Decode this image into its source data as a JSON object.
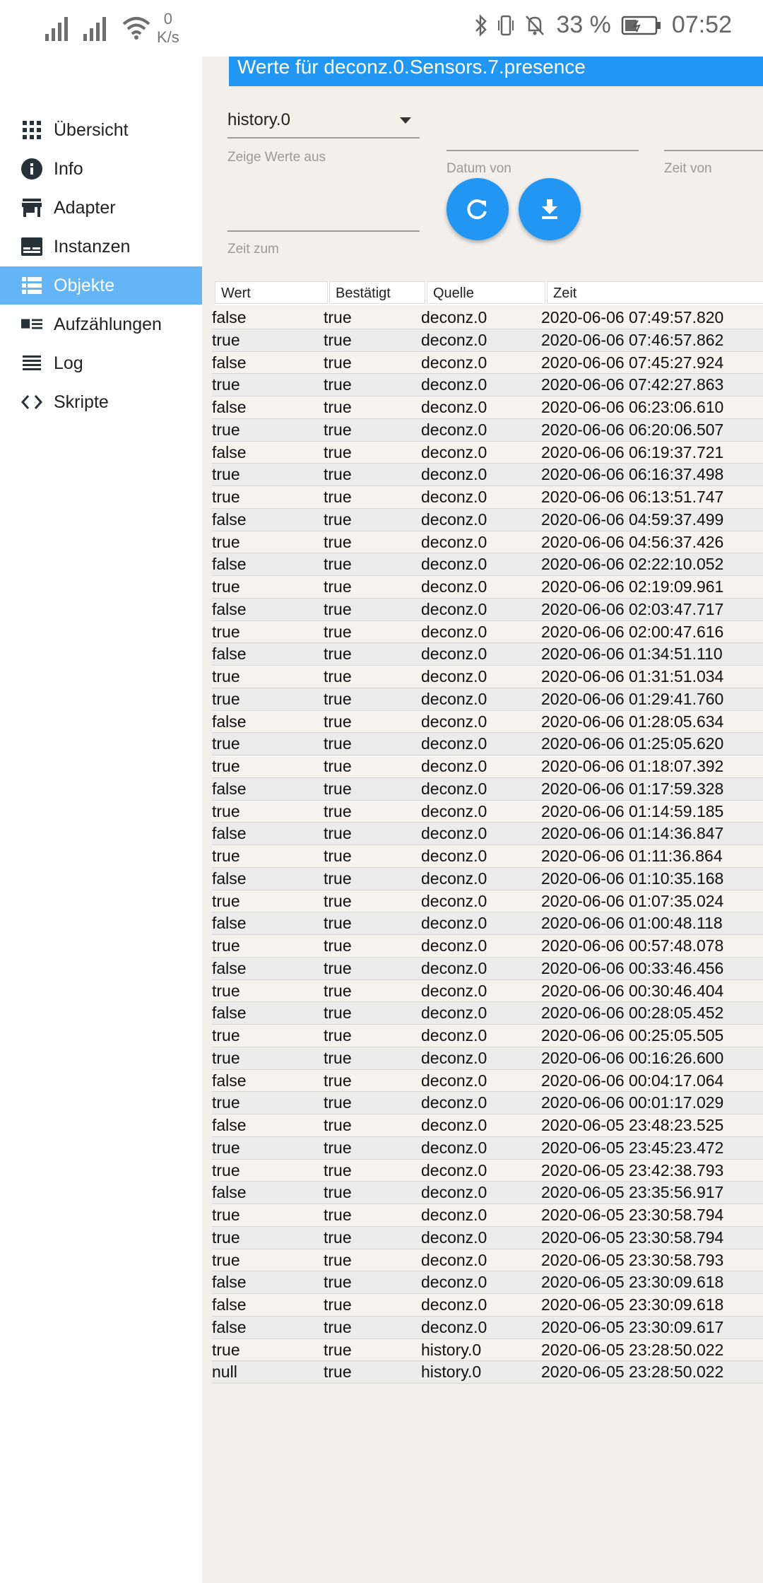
{
  "status_bar": {
    "net_speed_value": "0",
    "net_speed_unit": "K/s",
    "battery": "33 %",
    "time": "07:52"
  },
  "sidebar": {
    "items": [
      {
        "label": "Übersicht",
        "icon": "grid-icon"
      },
      {
        "label": "Info",
        "icon": "info-icon"
      },
      {
        "label": "Adapter",
        "icon": "store-icon"
      },
      {
        "label": "Instanzen",
        "icon": "instances-icon"
      },
      {
        "label": "Objekte",
        "icon": "list-icon",
        "active": true
      },
      {
        "label": "Aufzählungen",
        "icon": "enum-icon"
      },
      {
        "label": "Log",
        "icon": "log-icon"
      },
      {
        "label": "Skripte",
        "icon": "code-icon"
      }
    ],
    "active_color": "#64b5f6"
  },
  "main": {
    "title": "Werte für deconz.0.Sensors.7.presence",
    "accent": "#2196f3",
    "history_select": "history.0",
    "label_show_values": "Zeige Werte aus",
    "label_date_from": "Datum von",
    "label_time_from": "Zeit von",
    "label_time_to": "Zeit zum",
    "refresh_icon": "refresh-icon",
    "download_icon": "download-icon"
  },
  "table": {
    "columns": [
      "Wert",
      "Bestätigt",
      "Quelle",
      "Zeit"
    ],
    "rows": [
      [
        "false",
        "true",
        "deconz.0",
        "2020-06-06 07:49:57.820"
      ],
      [
        "true",
        "true",
        "deconz.0",
        "2020-06-06 07:46:57.862"
      ],
      [
        "false",
        "true",
        "deconz.0",
        "2020-06-06 07:45:27.924"
      ],
      [
        "true",
        "true",
        "deconz.0",
        "2020-06-06 07:42:27.863"
      ],
      [
        "false",
        "true",
        "deconz.0",
        "2020-06-06 06:23:06.610"
      ],
      [
        "true",
        "true",
        "deconz.0",
        "2020-06-06 06:20:06.507"
      ],
      [
        "false",
        "true",
        "deconz.0",
        "2020-06-06 06:19:37.721"
      ],
      [
        "true",
        "true",
        "deconz.0",
        "2020-06-06 06:16:37.498"
      ],
      [
        "true",
        "true",
        "deconz.0",
        "2020-06-06 06:13:51.747"
      ],
      [
        "false",
        "true",
        "deconz.0",
        "2020-06-06 04:59:37.499"
      ],
      [
        "true",
        "true",
        "deconz.0",
        "2020-06-06 04:56:37.426"
      ],
      [
        "false",
        "true",
        "deconz.0",
        "2020-06-06 02:22:10.052"
      ],
      [
        "true",
        "true",
        "deconz.0",
        "2020-06-06 02:19:09.961"
      ],
      [
        "false",
        "true",
        "deconz.0",
        "2020-06-06 02:03:47.717"
      ],
      [
        "true",
        "true",
        "deconz.0",
        "2020-06-06 02:00:47.616"
      ],
      [
        "false",
        "true",
        "deconz.0",
        "2020-06-06 01:34:51.110"
      ],
      [
        "true",
        "true",
        "deconz.0",
        "2020-06-06 01:31:51.034"
      ],
      [
        "true",
        "true",
        "deconz.0",
        "2020-06-06 01:29:41.760"
      ],
      [
        "false",
        "true",
        "deconz.0",
        "2020-06-06 01:28:05.634"
      ],
      [
        "true",
        "true",
        "deconz.0",
        "2020-06-06 01:25:05.620"
      ],
      [
        "true",
        "true",
        "deconz.0",
        "2020-06-06 01:18:07.392"
      ],
      [
        "false",
        "true",
        "deconz.0",
        "2020-06-06 01:17:59.328"
      ],
      [
        "true",
        "true",
        "deconz.0",
        "2020-06-06 01:14:59.185"
      ],
      [
        "false",
        "true",
        "deconz.0",
        "2020-06-06 01:14:36.847"
      ],
      [
        "true",
        "true",
        "deconz.0",
        "2020-06-06 01:11:36.864"
      ],
      [
        "false",
        "true",
        "deconz.0",
        "2020-06-06 01:10:35.168"
      ],
      [
        "true",
        "true",
        "deconz.0",
        "2020-06-06 01:07:35.024"
      ],
      [
        "false",
        "true",
        "deconz.0",
        "2020-06-06 01:00:48.118"
      ],
      [
        "true",
        "true",
        "deconz.0",
        "2020-06-06 00:57:48.078"
      ],
      [
        "false",
        "true",
        "deconz.0",
        "2020-06-06 00:33:46.456"
      ],
      [
        "true",
        "true",
        "deconz.0",
        "2020-06-06 00:30:46.404"
      ],
      [
        "false",
        "true",
        "deconz.0",
        "2020-06-06 00:28:05.452"
      ],
      [
        "true",
        "true",
        "deconz.0",
        "2020-06-06 00:25:05.505"
      ],
      [
        "true",
        "true",
        "deconz.0",
        "2020-06-06 00:16:26.600"
      ],
      [
        "false",
        "true",
        "deconz.0",
        "2020-06-06 00:04:17.064"
      ],
      [
        "true",
        "true",
        "deconz.0",
        "2020-06-06 00:01:17.029"
      ],
      [
        "false",
        "true",
        "deconz.0",
        "2020-06-05 23:48:23.525"
      ],
      [
        "true",
        "true",
        "deconz.0",
        "2020-06-05 23:45:23.472"
      ],
      [
        "true",
        "true",
        "deconz.0",
        "2020-06-05 23:42:38.793"
      ],
      [
        "false",
        "true",
        "deconz.0",
        "2020-06-05 23:35:56.917"
      ],
      [
        "true",
        "true",
        "deconz.0",
        "2020-06-05 23:30:58.794"
      ],
      [
        "true",
        "true",
        "deconz.0",
        "2020-06-05 23:30:58.794"
      ],
      [
        "true",
        "true",
        "deconz.0",
        "2020-06-05 23:30:58.793"
      ],
      [
        "false",
        "true",
        "deconz.0",
        "2020-06-05 23:30:09.618"
      ],
      [
        "false",
        "true",
        "deconz.0",
        "2020-06-05 23:30:09.618"
      ],
      [
        "false",
        "true",
        "deconz.0",
        "2020-06-05 23:30:09.617"
      ],
      [
        "true",
        "true",
        "history.0",
        "2020-06-05 23:28:50.022"
      ],
      [
        "null",
        "true",
        "history.0",
        "2020-06-05 23:28:50.022"
      ]
    ]
  }
}
